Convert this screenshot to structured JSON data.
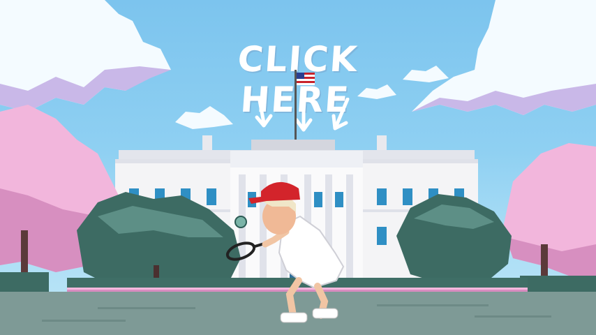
{
  "cta": {
    "label": "CLICK HERE"
  },
  "colors": {
    "sky": "#8fd0f2",
    "cloud": "#ffffff",
    "blossom": "#f2b6dc",
    "tree": "#3d6b63",
    "white_house": "#f4f4f6",
    "cap": "#d3242b",
    "ground": "#7e9a96"
  },
  "icons": [
    "flag-icon",
    "down-arrow-icon",
    "tennis-racket-icon",
    "tennis-ball-icon"
  ]
}
